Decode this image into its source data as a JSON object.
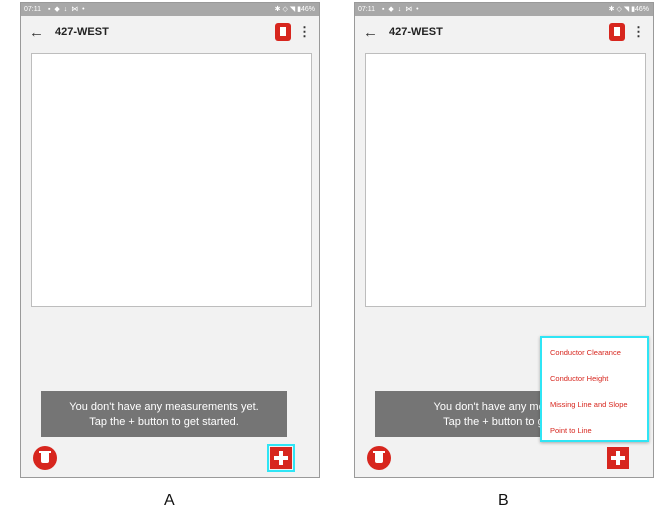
{
  "phones": [
    {
      "status": {
        "time": "07:11",
        "icons": "▪ ◆ ↓ ⋈ •",
        "right": "✱ ◇ ◥ ▮46%"
      },
      "appbar": {
        "back": "←",
        "title": "427-WEST",
        "overflow": "⋮"
      },
      "toast": {
        "line1": "You don't have any measurements yet.",
        "line2": "Tap the + button to get started."
      },
      "caption": "A"
    },
    {
      "status": {
        "time": "07:11",
        "icons": "▪ ◆ ↓ ⋈ •",
        "right": "✱ ◇ ◥ ▮46%"
      },
      "appbar": {
        "back": "←",
        "title": "427-WEST",
        "overflow": "⋮"
      },
      "toast": {
        "line1": "You don't have any measu",
        "line2": "Tap the + button to get"
      },
      "menu_items": [
        "Conductor Clearance",
        "Conductor Height",
        "Missing Line and Slope",
        "Point to Line"
      ],
      "caption": "B"
    }
  ],
  "colors": {
    "accent": "#d7261e",
    "highlight": "#2fe5f5",
    "toast_bg": "#757575"
  },
  "icons": {
    "back": "arrow-left-icon",
    "clipboard": "clipboard-icon",
    "menu": "more-vert-icon",
    "trash": "trash-icon",
    "add": "plus-icon"
  }
}
